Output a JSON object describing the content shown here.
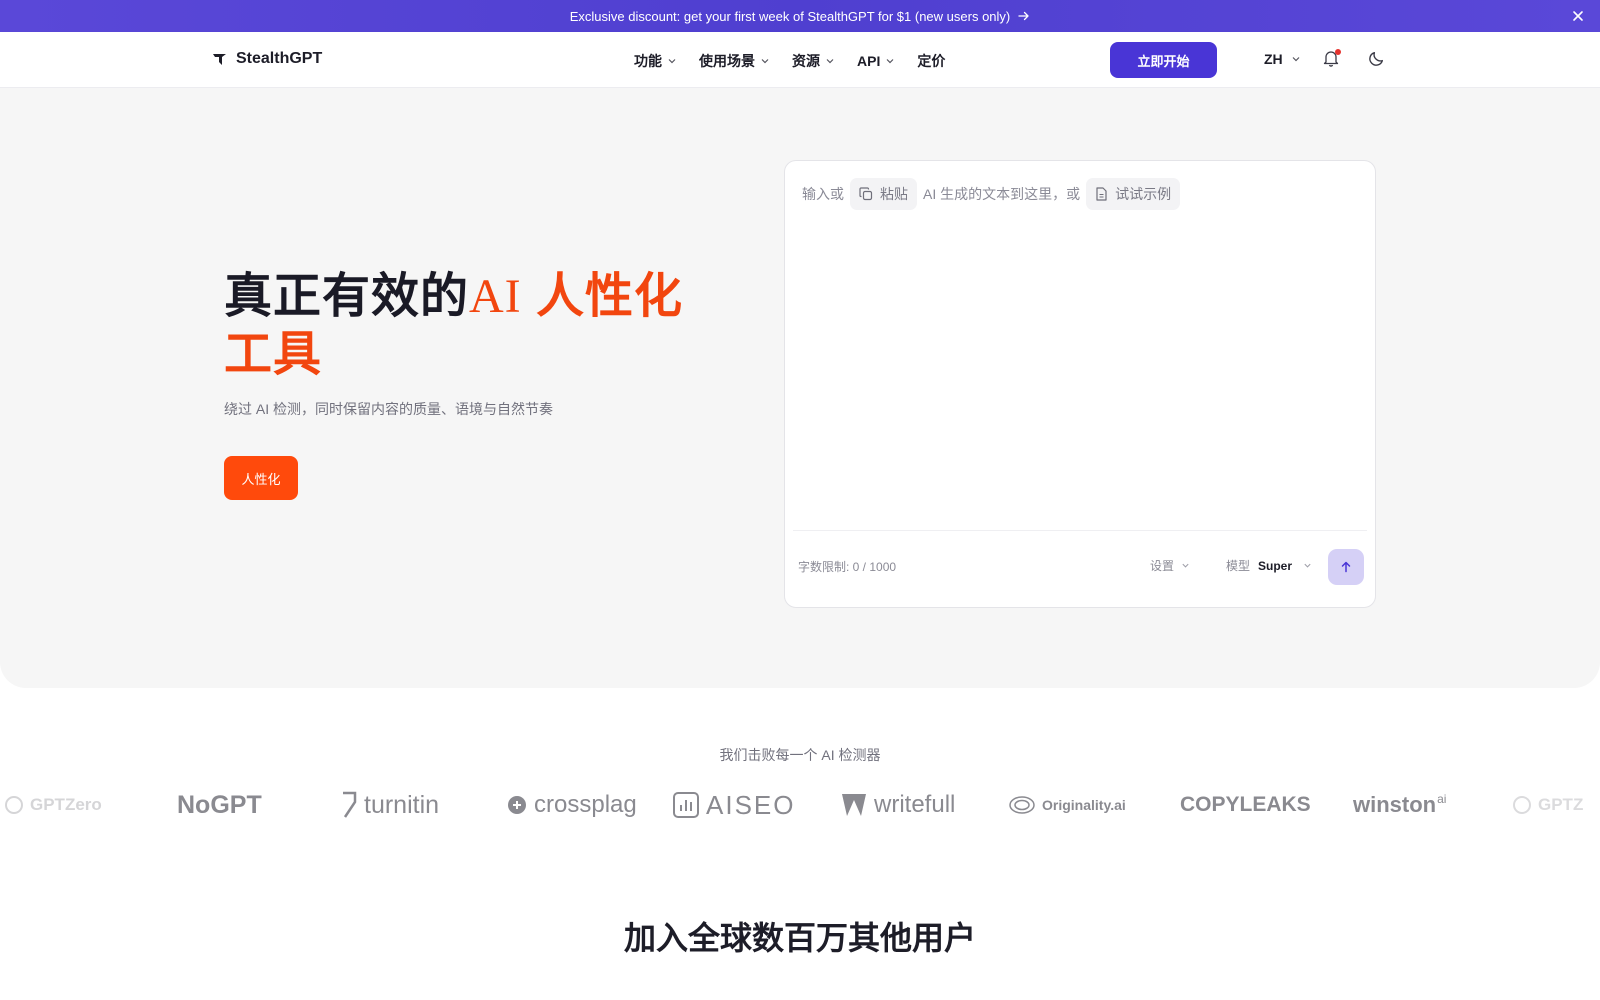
{
  "banner": {
    "text": "Exclusive discount: get your first week of StealthGPT for $1 (new users only)",
    "icon_arrow": "arrow-right-icon",
    "icon_close": "close-icon"
  },
  "nav": {
    "brand": "StealthGPT",
    "menu": [
      "功能",
      "使用场景",
      "资源",
      "API",
      "定价"
    ],
    "cta": "立即开始",
    "lang": "ZH"
  },
  "hero": {
    "title_part1": "真正有效的",
    "title_ai": "AI",
    "title_part2": " 人性化工具",
    "subtitle": "绕过 AI 检测，同时保留内容的质量、语境与自然节奏",
    "humanize_button": "人性化"
  },
  "editor": {
    "prompt_before": "输入或",
    "paste_label": "粘贴",
    "prompt_middle": "AI 生成的文本到这里，或",
    "sample_label": "试试示例",
    "char_limit": "字数限制: 0 / 1000",
    "settings_label": "设置",
    "model_label": "模型",
    "model_value": "Super"
  },
  "detectors": {
    "heading": "我们击败每一个 AI 检测器",
    "logos": [
      "GPTZero",
      "NoGPT",
      "turnitin",
      "crossplag",
      "AISEO",
      "writefull",
      "Originality.ai",
      "COPYLEAKS",
      "winston",
      "GPTZ"
    ],
    "winston_suffix": "ai"
  },
  "join": {
    "heading": "加入全球数百万其他用户"
  },
  "colors": {
    "banner": "#4f3fd0",
    "cta": "#4935d6",
    "accent": "#f2460f",
    "humanize": "#ff4a0c",
    "hero_bg": "#f6f6f6"
  }
}
